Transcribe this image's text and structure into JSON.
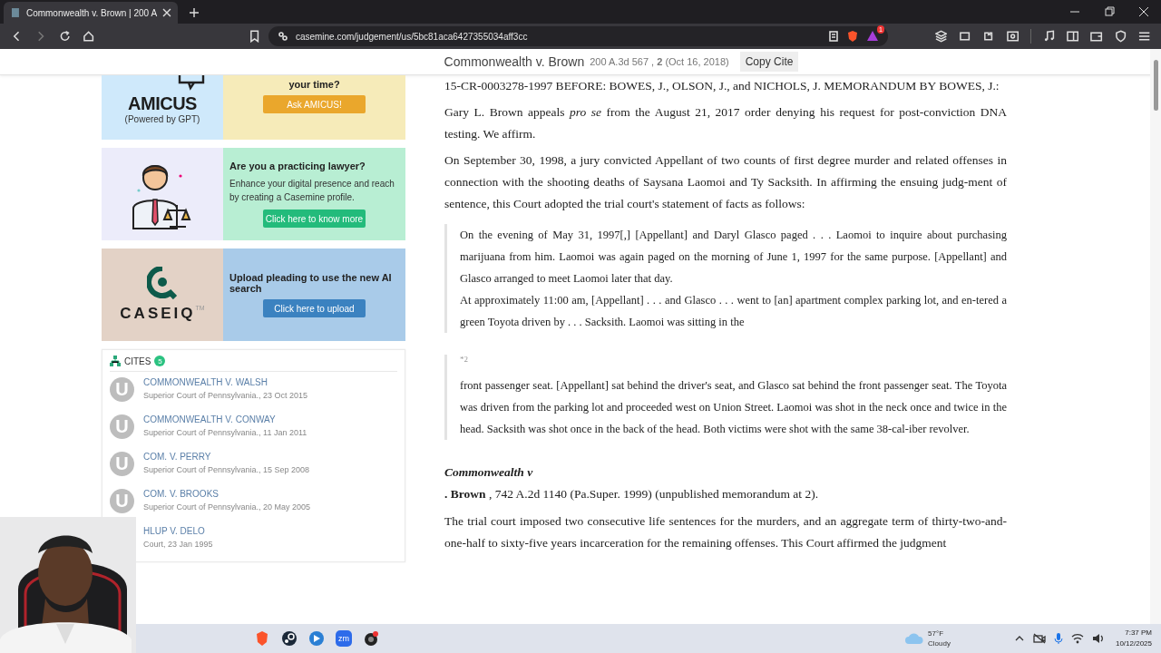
{
  "browser": {
    "tab_title": "Commonwealth v. Brown | 200 A",
    "url": "casemine.com/judgement/us/5bc81aca6427355034aff3cc",
    "rewards_badge": "1"
  },
  "header": {
    "title": "Commonwealth v. Brown",
    "citation": "200 A.3d 567 , **2** (Oct 16, 2018)",
    "button": "Copy Cite"
  },
  "promos": [
    {
      "kind": "amicus",
      "logo": "AMICUS",
      "logo_sub": "(Powered by GPT)",
      "heading": "your time?",
      "button": "Ask AMICUS!"
    },
    {
      "kind": "lawyer",
      "heading": "Are you a practicing lawyer?",
      "text": "Enhance your digital presence and reach by creating a Casemine profile.",
      "button": "Click here to know more"
    },
    {
      "kind": "caseiq",
      "logo": "CASEIQ",
      "logo_mark": "TM",
      "heading": "Upload pleading to use the new AI search",
      "button": "Click here to upload"
    }
  ],
  "cites": {
    "title": "CITES",
    "count": "5",
    "items": [
      {
        "avatar": "U",
        "name": "COMMONWEALTH V. WALSH",
        "court": "Superior Court of Pennsylvania., 23 Oct 2015"
      },
      {
        "avatar": "U",
        "name": "COMMONWEALTH V. CONWAY",
        "court": "Superior Court of Pennsylvania., 11 Jan 2011"
      },
      {
        "avatar": "U",
        "name": "COM. V. PERRY",
        "court": "Superior Court of Pennsylvania., 15 Sep 2008"
      },
      {
        "avatar": "U",
        "name": "COM. V. BROOKS",
        "court": "Superior Court of Pennsylvania., 20 May 2005"
      },
      {
        "name": "HLUP V. DELO",
        "court": "Court, 23 Jan 1995"
      }
    ]
  },
  "document": [
    {
      "kind": "para",
      "text": "15-CR-0003278-1997 BEFORE: BOWES, J., OLSON, J., and NICHOLS, J. MEMORANDUM BY BOWES, J.:"
    },
    {
      "kind": "para",
      "text": "Gary L. Brown appeals *pro se* from the August 21, 2017 order denying his request for post-conviction DNA testing. We affirm."
    },
    {
      "kind": "para",
      "text": "On September 30, 1998, a jury convicted Appellant of two counts of first degree murder and related offenses in connection with the shooting deaths of Saysana Laomoi and Ty Sacksith. In affirming the ensuing judg-ment of sentence, this Court adopted the trial court's statement of facts as follows:"
    },
    {
      "kind": "quote",
      "paragraphs": [
        "On the evening of May 31, 1997[,] [Appellant] and Daryl Glasco paged . . . Laomoi to inquire about purchasing marijuana from him. Laomoi was again paged on the morning of June 1, 1997 for the same purpose. [Appellant] and Glasco arranged to meet Laomoi later that day.",
        "At approximately 11:00 am, [Appellant] . . . and Glasco . . . went to [an] apartment complex parking lot, and en-tered a green Toyota driven by . . . Sacksith. Laomoi was sitting in the"
      ]
    },
    {
      "kind": "quote",
      "page_marker": "*2",
      "paragraphs": [
        "front passenger seat. [Appellant] sat behind the driver's seat, and Glasco sat behind the front passenger seat. The Toyota was driven from the parking lot and proceeded west on Union Street. Laomoi was shot in the neck once and twice in the head. Sacksith was shot once in the back of the head. Both victims were shot with the same 38-cal-iber revolver."
      ]
    },
    {
      "kind": "case_title",
      "text": "Commonwealth v"
    },
    {
      "kind": "cite",
      "text": "**. Brown** , 742 A.2d 1140 (Pa.Super. 1999) (unpublished memorandum at 2)."
    },
    {
      "kind": "para",
      "text": "The trial court imposed two consecutive life sentences for the murders, and an aggregate term of thirty-two-and-one-half to sixty-five years incarceration for the remaining offenses. This Court affirmed the judgment"
    }
  ],
  "taskbar": {
    "apps": [
      {
        "kind": "brave"
      },
      {
        "kind": "steam"
      },
      {
        "kind": "blue"
      },
      {
        "kind": "zoom",
        "label": "zm"
      },
      {
        "kind": "obs"
      }
    ],
    "weather": {
      "temp": "57°F",
      "condition": "Cloudy"
    },
    "clock": {
      "time": "7:37 PM",
      "date": "10/12/2025"
    }
  }
}
